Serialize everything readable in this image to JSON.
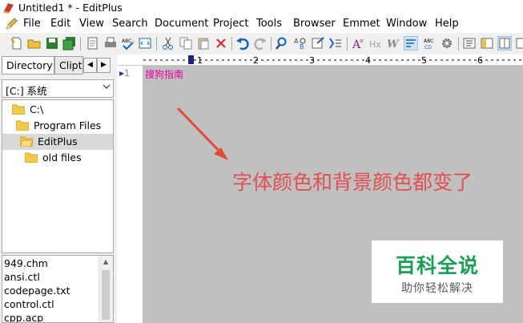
{
  "window": {
    "title": "Untitled1 * - EditPlus",
    "app_icon": "editplus-logo-icon"
  },
  "menu": {
    "icon": "pencil-icon",
    "items": [
      "File",
      "Edit",
      "View",
      "Search",
      "Document",
      "Project",
      "Tools",
      "Browser",
      "Emmet",
      "Window",
      "Help"
    ]
  },
  "toolbar": {
    "icons": [
      "new-file-icon",
      "open-folder-icon",
      "save-icon",
      "save-all-icon",
      "print-preview-icon",
      "print-icon",
      "spellcheck-icon",
      "browser-icon",
      "cut-icon",
      "copy-icon",
      "paste-icon",
      "delete-icon",
      "undo-icon",
      "redo-icon",
      "find-icon",
      "replace-icon",
      "goto-file-icon",
      "goto-line-icon",
      "font-icon",
      "header-icon",
      "italic-w-icon",
      "wrap-icon",
      "abc-icon",
      "settings-gear-icon",
      "panel-left-icon",
      "panel-right-icon",
      "split-view-icon",
      "window-icon"
    ]
  },
  "sidebar": {
    "tabs": [
      "Directory",
      "Clipt"
    ],
    "drive": "[C:] 系统",
    "tree": [
      {
        "label": "C:\\",
        "level": 0,
        "selected": false
      },
      {
        "label": "Program Files",
        "level": 1,
        "selected": false
      },
      {
        "label": "EditPlus",
        "level": 1,
        "selected": true
      },
      {
        "label": "old files",
        "level": 2,
        "selected": false
      }
    ],
    "files": [
      "949.chm",
      "ansi.ctl",
      "codepage.txt",
      "control.ctl",
      "cpp.acp"
    ]
  },
  "editor": {
    "ruler_marks": [
      "1",
      "2",
      "3",
      "4",
      "5",
      "6"
    ],
    "line_numbers": [
      "1"
    ],
    "lines": [
      "搜狗指南"
    ],
    "text_color": "#e8009c",
    "background_color": "#c0c0c0"
  },
  "annotation": {
    "text": "字体颜色和背景颜色都变了",
    "color": "#e05050"
  },
  "watermark": {
    "title": "百科全说",
    "subtitle": "助你轻松解决"
  }
}
